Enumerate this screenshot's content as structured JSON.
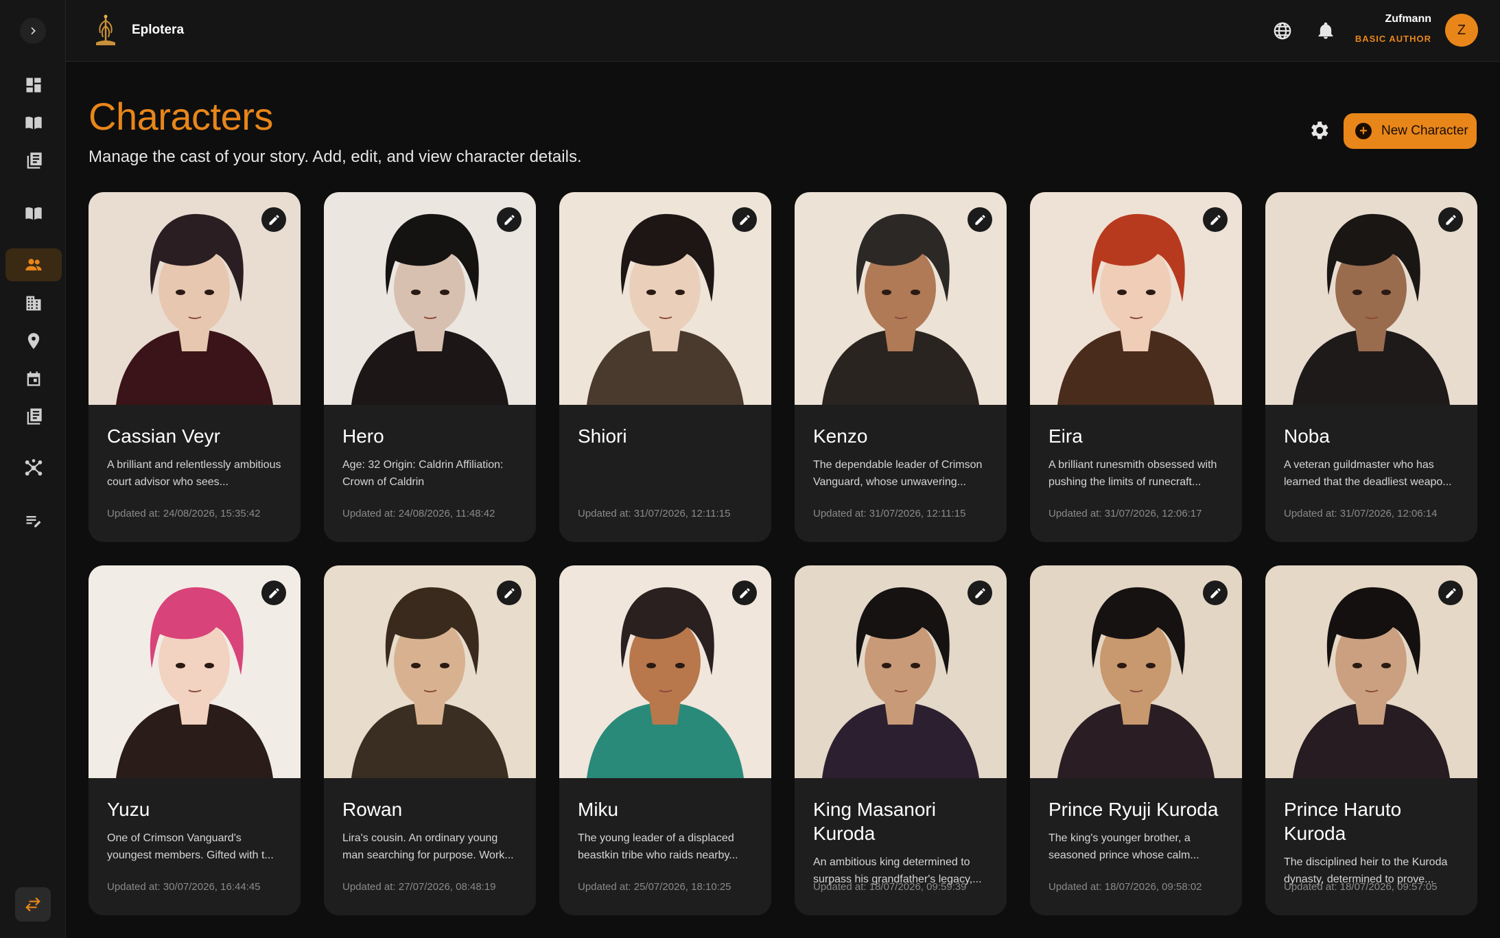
{
  "app": {
    "brand": "Eplotera"
  },
  "user": {
    "name": "Zufmann",
    "role": "BASIC AUTHOR",
    "initial": "Z"
  },
  "header": {
    "title": "Characters",
    "subtitle": "Manage the cast of your story. Add, edit, and view character details.",
    "new_button_label": "New Character"
  },
  "sidebar": {
    "items": [
      {
        "icon": "dashboard-icon"
      },
      {
        "icon": "book-open-icon"
      },
      {
        "icon": "library-icon"
      },
      {
        "icon": "book-icon"
      },
      {
        "icon": "characters-icon",
        "active": true
      },
      {
        "icon": "building-icon"
      },
      {
        "icon": "location-pin-icon"
      },
      {
        "icon": "calendar-icon"
      },
      {
        "icon": "notes-icon"
      },
      {
        "icon": "network-icon"
      },
      {
        "icon": "edit-list-icon"
      }
    ],
    "bottom_icon": "swap-icon"
  },
  "colors": {
    "accent": "#e8861a",
    "background": "#0e0e0e",
    "card": "#1e1e1e"
  },
  "characters": [
    {
      "name": "Cassian Veyr",
      "description": "A brilliant and relentlessly ambitious court advisor who sees...",
      "updated": "Updated at: 24/08/2026, 15:35:42",
      "hair": "#2a1e22",
      "bg": "#e9ddd2",
      "skin": "#e8c7b0",
      "cloth": "#3a1418"
    },
    {
      "name": "Hero",
      "description": "Age: 32 Origin: Caldrin Affiliation: Crown of Caldrin",
      "updated": "Updated at: 24/08/2026, 11:48:42",
      "hair": "#151212",
      "bg": "#ebe6e0",
      "skin": "#d8c0b0",
      "cloth": "#1c1616"
    },
    {
      "name": "Shiori",
      "description": "",
      "updated": "Updated at: 31/07/2026, 12:11:15",
      "hair": "#1e1614",
      "bg": "#eee4d8",
      "skin": "#ead0ba",
      "cloth": "#4a3a2e"
    },
    {
      "name": "Kenzo",
      "description": "The dependable leader of Crimson Vanguard, whose unwavering...",
      "updated": "Updated at: 31/07/2026, 12:11:15",
      "hair": "#2c2826",
      "bg": "#ece2d6",
      "skin": "#b07a56",
      "cloth": "#2a2420"
    },
    {
      "name": "Eira",
      "description": "A brilliant runesmith obsessed with pushing the limits of runecraft...",
      "updated": "Updated at: 31/07/2026, 12:06:17",
      "hair": "#b83a1e",
      "bg": "#eee2d6",
      "skin": "#efcdb6",
      "cloth": "#4a2c1c"
    },
    {
      "name": "Noba",
      "description": "A veteran guildmaster who has learned that the deadliest weapo...",
      "updated": "Updated at: 31/07/2026, 12:06:14",
      "hair": "#1a1614",
      "bg": "#e8dccf",
      "skin": "#9a6c4e",
      "cloth": "#1e1a1a"
    },
    {
      "name": "Yuzu",
      "description": "One of Crimson Vanguard's youngest members. Gifted with t...",
      "updated": "Updated at: 30/07/2026, 16:44:45",
      "hair": "#d8437a",
      "bg": "#f2ece6",
      "skin": "#f2d2c0",
      "cloth": "#2a1c18"
    },
    {
      "name": "Rowan",
      "description": "Lira's cousin. An ordinary young man searching for purpose. Work...",
      "updated": "Updated at: 27/07/2026, 08:48:19",
      "hair": "#3a2a1e",
      "bg": "#e8dccc",
      "skin": "#d8b290",
      "cloth": "#3a2e22"
    },
    {
      "name": "Miku",
      "description": "The young leader of a displaced beastkin tribe who raids nearby...",
      "updated": "Updated at: 25/07/2026, 18:10:25",
      "hair": "#2a2020",
      "bg": "#f0e6dc",
      "skin": "#b8784c",
      "cloth": "#2a8a7a"
    },
    {
      "name": "King Masanori Kuroda",
      "description": "An ambitious king determined to surpass his grandfather's legacy,...",
      "updated": "Updated at: 18/07/2026, 09:59:39",
      "hair": "#161212",
      "bg": "#e4d8c8",
      "skin": "#c89a78",
      "cloth": "#2c2030"
    },
    {
      "name": "Prince Ryuji Kuroda",
      "description": "The king's younger brother, a seasoned prince whose calm...",
      "updated": "Updated at: 18/07/2026, 09:58:02",
      "hair": "#161212",
      "bg": "#e4d6c4",
      "skin": "#c8986e",
      "cloth": "#2a1e24"
    },
    {
      "name": "Prince Haruto Kuroda",
      "description": "The disciplined heir to the Kuroda dynasty, determined to prove...",
      "updated": "Updated at: 18/07/2026, 09:57:05",
      "hair": "#141010",
      "bg": "#e6d8c6",
      "skin": "#caa080",
      "cloth": "#261c22"
    }
  ]
}
